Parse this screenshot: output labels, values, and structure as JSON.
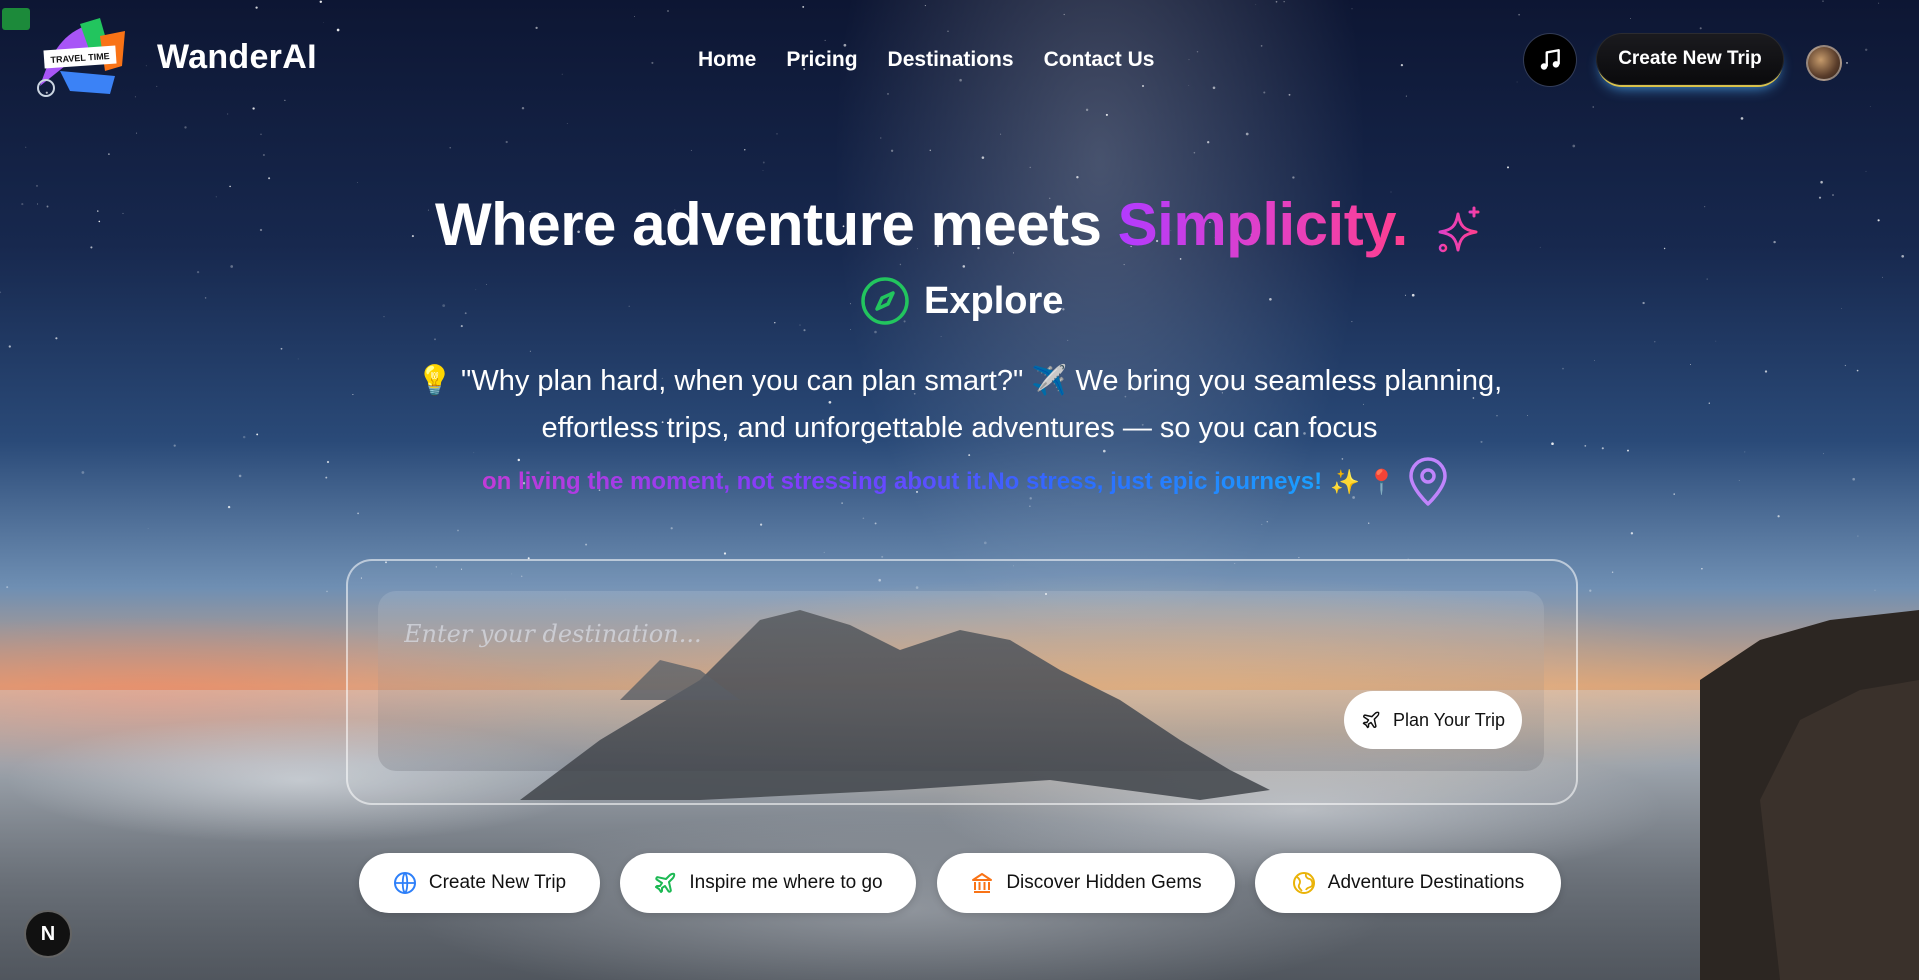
{
  "brand": {
    "name": "WanderAI",
    "logo_text": "TRAVEL TIME"
  },
  "nav": {
    "items": [
      "Home",
      "Pricing",
      "Destinations",
      "Contact Us"
    ]
  },
  "header": {
    "music_icon": "music-note-icon",
    "create_trip_label": "Create New Trip"
  },
  "hero": {
    "headline": "Where adventure meets",
    "headline_accent": "Simplicity.",
    "explore": "Explore",
    "line1_emoji": "💡",
    "line1_quote": "\"Why plan hard, when you can plan smart?\"",
    "line1_emoji2": "✈️",
    "line1_rest": "We bring you seamless planning,",
    "line2": "effortless trips, and unforgettable adventures — so you can focus",
    "line3_gradient": "on living the moment, not stressing about it.No stress, just epic journeys!",
    "line3_emojis": "✨ 📍"
  },
  "search": {
    "placeholder": "Enter your destination...",
    "value": "",
    "plan_button_label": "Plan Your Trip"
  },
  "quick_actions": [
    {
      "label": "Create New Trip",
      "icon": "globe-icon",
      "color": "#2d7ff9"
    },
    {
      "label": "Inspire me where to go",
      "icon": "plane-icon",
      "color": "#1db954"
    },
    {
      "label": "Discover Hidden Gems",
      "icon": "landmark-icon",
      "color": "#f97316"
    },
    {
      "label": "Adventure Destinations",
      "icon": "globe-icon",
      "color": "#eab308"
    }
  ],
  "corner_badge": "N",
  "colors": {
    "accent_start": "#b23bff",
    "accent_end": "#ff3f8e",
    "compass_green": "#22c55e",
    "pin_purple": "#c084fc"
  }
}
